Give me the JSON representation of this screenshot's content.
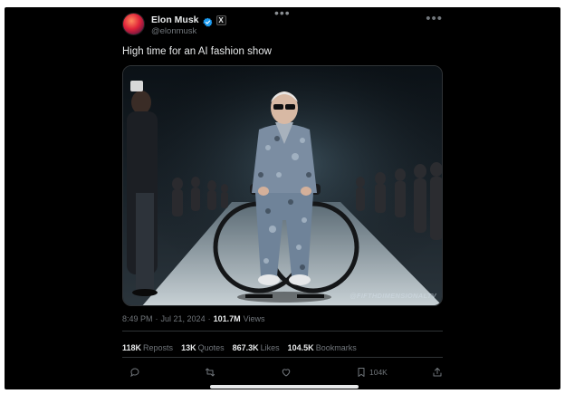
{
  "author": {
    "display_name": "Elon Musk",
    "handle": "@elonmusk",
    "verified": true,
    "affiliation_badge": "X"
  },
  "tweet": {
    "text": "High time for an AI fashion show",
    "media_watermark": "@FIFTHDIMENSIONALTV",
    "time": "8:49 PM",
    "separator": "·",
    "date": "Jul 21, 2024",
    "views_count": "101.7M",
    "views_label": "Views"
  },
  "stats": [
    {
      "count": "118K",
      "label": "Reposts"
    },
    {
      "count": "13K",
      "label": "Quotes"
    },
    {
      "count": "867.3K",
      "label": "Likes"
    },
    {
      "count": "104.5K",
      "label": "Bookmarks"
    }
  ],
  "actions": {
    "bookmark_count": "104K"
  },
  "icons": {
    "verified": "verified-badge-icon",
    "reply": "reply-icon",
    "repost": "repost-icon",
    "like": "heart-icon",
    "bookmark": "bookmark-icon",
    "share": "share-icon",
    "more": "more-icon"
  },
  "colors": {
    "background": "#000000",
    "text_primary": "#e7e9ea",
    "text_secondary": "#71767b",
    "verified_blue": "#1d9bf0",
    "divider": "#2f3336"
  }
}
